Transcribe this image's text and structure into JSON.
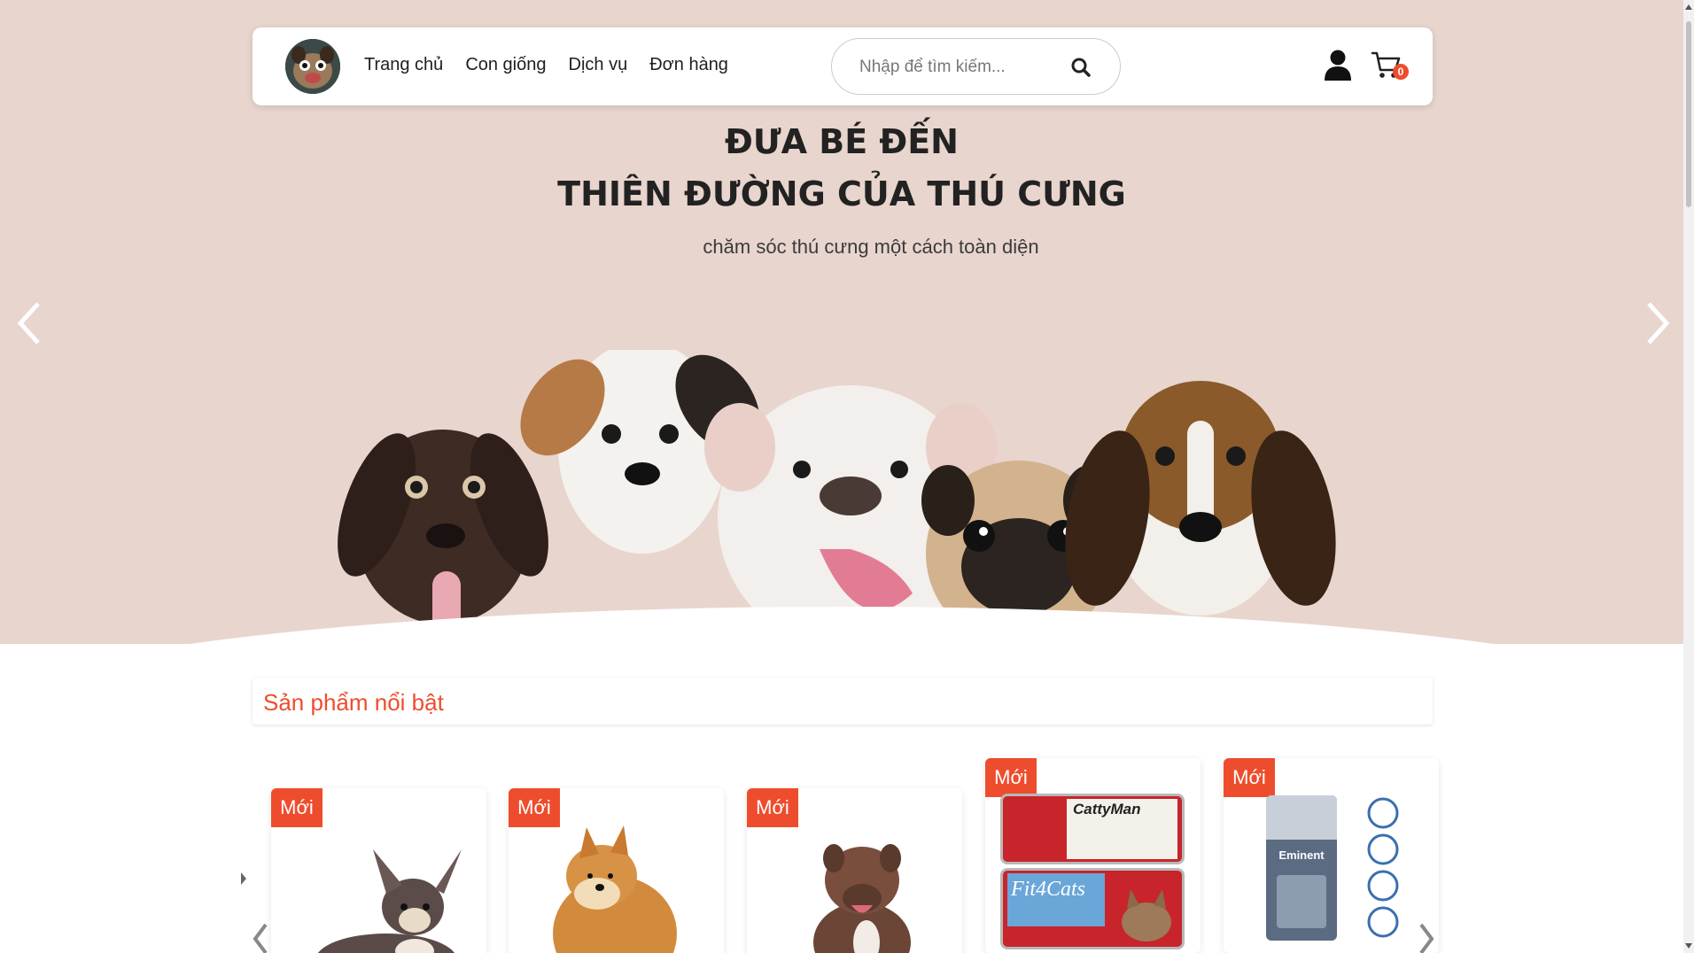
{
  "nav": {
    "links": [
      "Trang chủ",
      "Con giống",
      "Dịch vụ",
      "Đơn hàng"
    ],
    "search_placeholder": "Nhập để tìm kiếm...",
    "cart_count": "0"
  },
  "hero": {
    "title_line1": "ĐƯA BÉ ĐẾN",
    "title_line2": "THIÊN ĐƯỜNG CỦA THÚ CƯNG",
    "subtitle": "chăm sóc thú cưng một cách toàn diện"
  },
  "featured": {
    "title": "Sản phẩm nổi bật",
    "badge": "Mới",
    "products": [
      {
        "image": "chihuahua"
      },
      {
        "image": "shiba-doge"
      },
      {
        "image": "pitbull"
      },
      {
        "image": "fit4cats-can",
        "brand_top": "CattyMan",
        "brand": "Fit4Cats"
      },
      {
        "image": "eminent-food-bag",
        "brand": "Eminent"
      }
    ]
  },
  "colors": {
    "accent": "#ee4d2d",
    "hero_bg": "#e8d5cd"
  }
}
